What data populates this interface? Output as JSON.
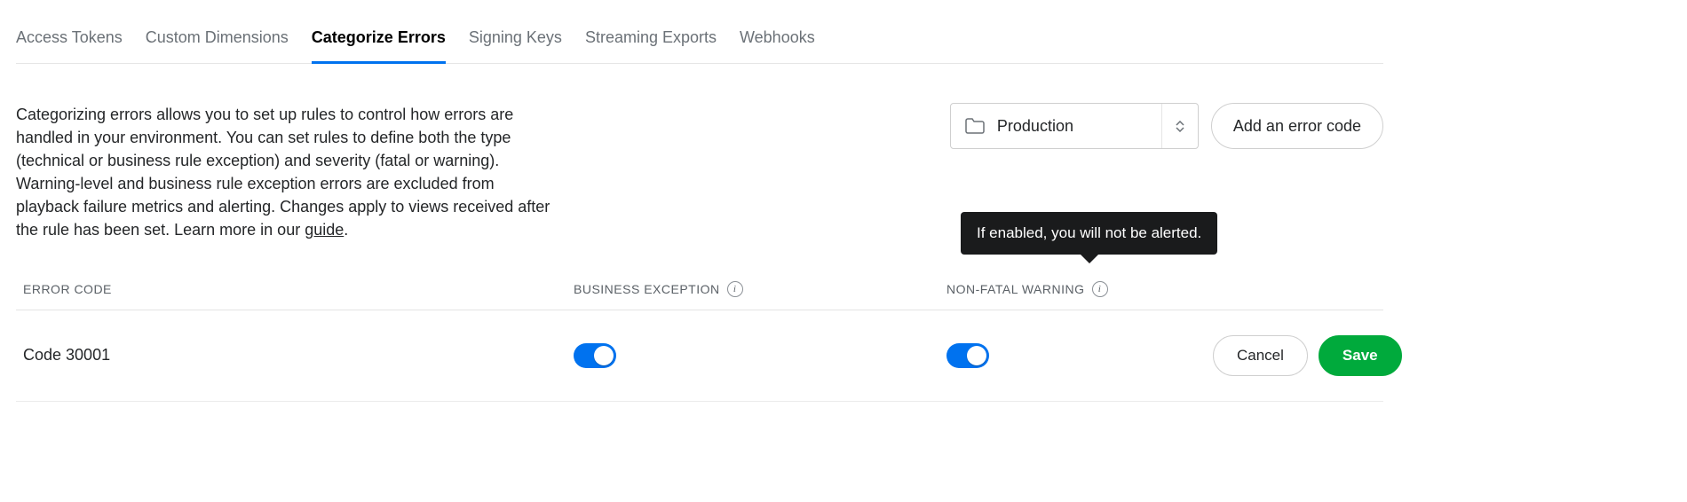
{
  "tabs": [
    {
      "label": "Access Tokens",
      "active": false
    },
    {
      "label": "Custom Dimensions",
      "active": false
    },
    {
      "label": "Categorize Errors",
      "active": true
    },
    {
      "label": "Signing Keys",
      "active": false
    },
    {
      "label": "Streaming Exports",
      "active": false
    },
    {
      "label": "Webhooks",
      "active": false
    }
  ],
  "description": {
    "text": "Categorizing errors allows you to set up rules to control how errors are handled in your environment. You can set rules to define both the type (technical or business rule exception) and severity (fatal or warning). Warning-level and business rule exception errors are excluded from playback failure metrics and alerting. Changes apply to views received after the rule has been set. Learn more in our ",
    "link_label": "guide",
    "suffix": "."
  },
  "env_selector": {
    "value": "Production"
  },
  "buttons": {
    "add_error_code": "Add an error code",
    "cancel": "Cancel",
    "save": "Save"
  },
  "columns": {
    "error_code": "ERROR CODE",
    "business_exception": "BUSINESS EXCEPTION",
    "non_fatal_warning": "NON-FATAL WARNING"
  },
  "tooltip": {
    "non_fatal_warning": "If enabled, you will not be alerted."
  },
  "rows": [
    {
      "code": "Code 30001",
      "business_exception_on": true,
      "non_fatal_warning_on": true
    }
  ]
}
